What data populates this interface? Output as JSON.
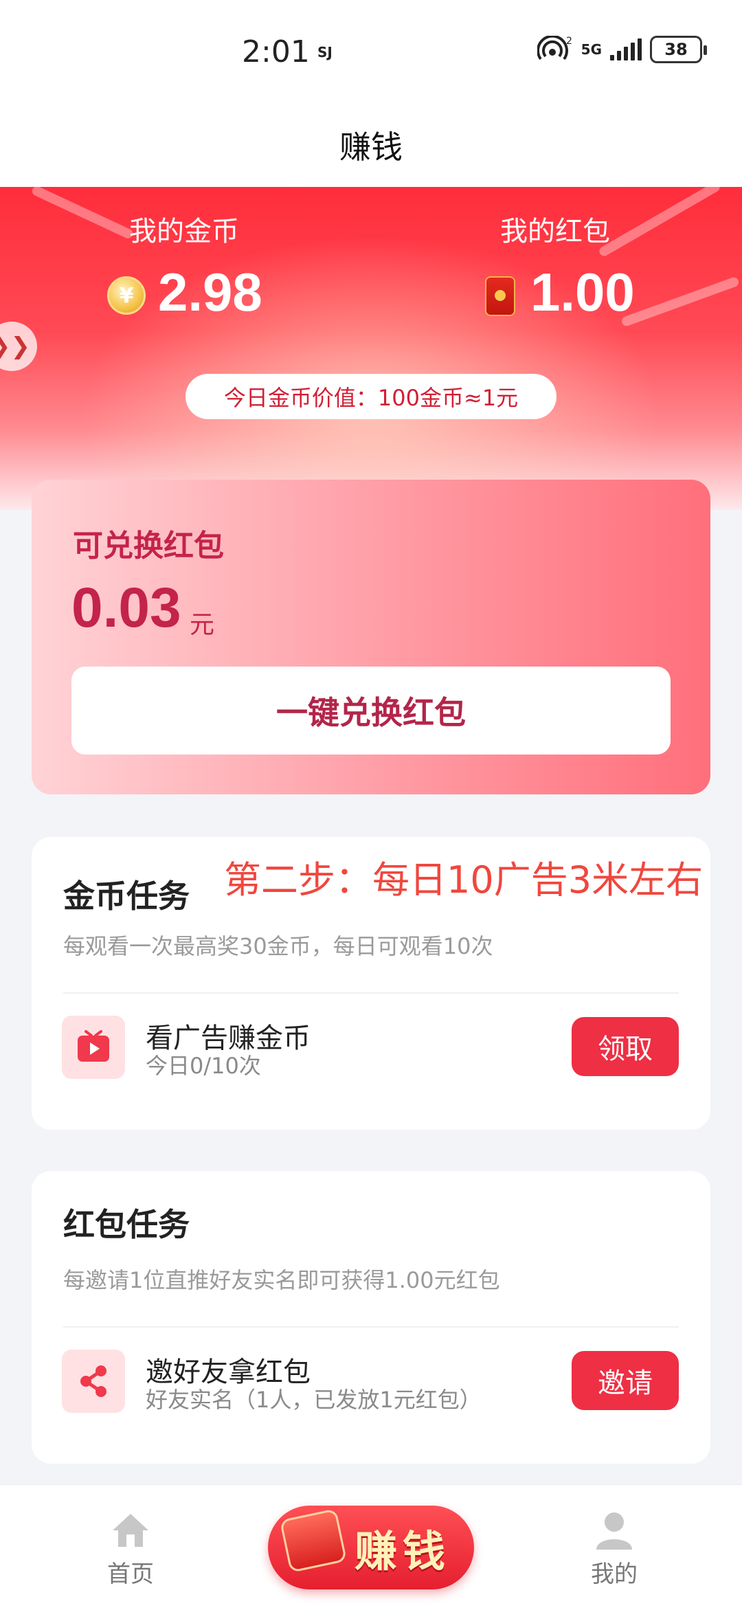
{
  "status_bar": {
    "time": "2:01",
    "small_icon_text": "SJ",
    "network": "5G",
    "battery": "38"
  },
  "header": {
    "title": "赚钱"
  },
  "hero": {
    "coins_label": "我的金币",
    "coins_value": "2.98",
    "coin_symbol": "¥",
    "redpacket_label": "我的红包",
    "redpacket_value": "1.00",
    "coin_value_text": "今日金币价值：100金币≈1元"
  },
  "exchange": {
    "title": "可兑换红包",
    "amount": "0.03",
    "unit": "元",
    "button": "一键兑换红包"
  },
  "coin_task": {
    "title": "金币任务",
    "description": "每观看一次最高奖30金币，每日可观看10次",
    "row_name": "看广告赚金币",
    "row_sub": "今日0/10次",
    "button": "领取"
  },
  "annotation": "第二步：每日10广告3米左右",
  "redpacket_task": {
    "title": "红包任务",
    "description": "每邀请1位直推好友实名即可获得1.00元红包",
    "row_name": "邀好友拿红包",
    "row_sub": "好友实名（1人，已发放1元红包）",
    "button": "邀请"
  },
  "bottom_nav": {
    "home": "首页",
    "earn": "赚钱",
    "mine": "我的"
  },
  "colors": {
    "accent_red": "#ee2f44",
    "exchange_text": "#c4234b",
    "annotation": "#f0473e"
  }
}
